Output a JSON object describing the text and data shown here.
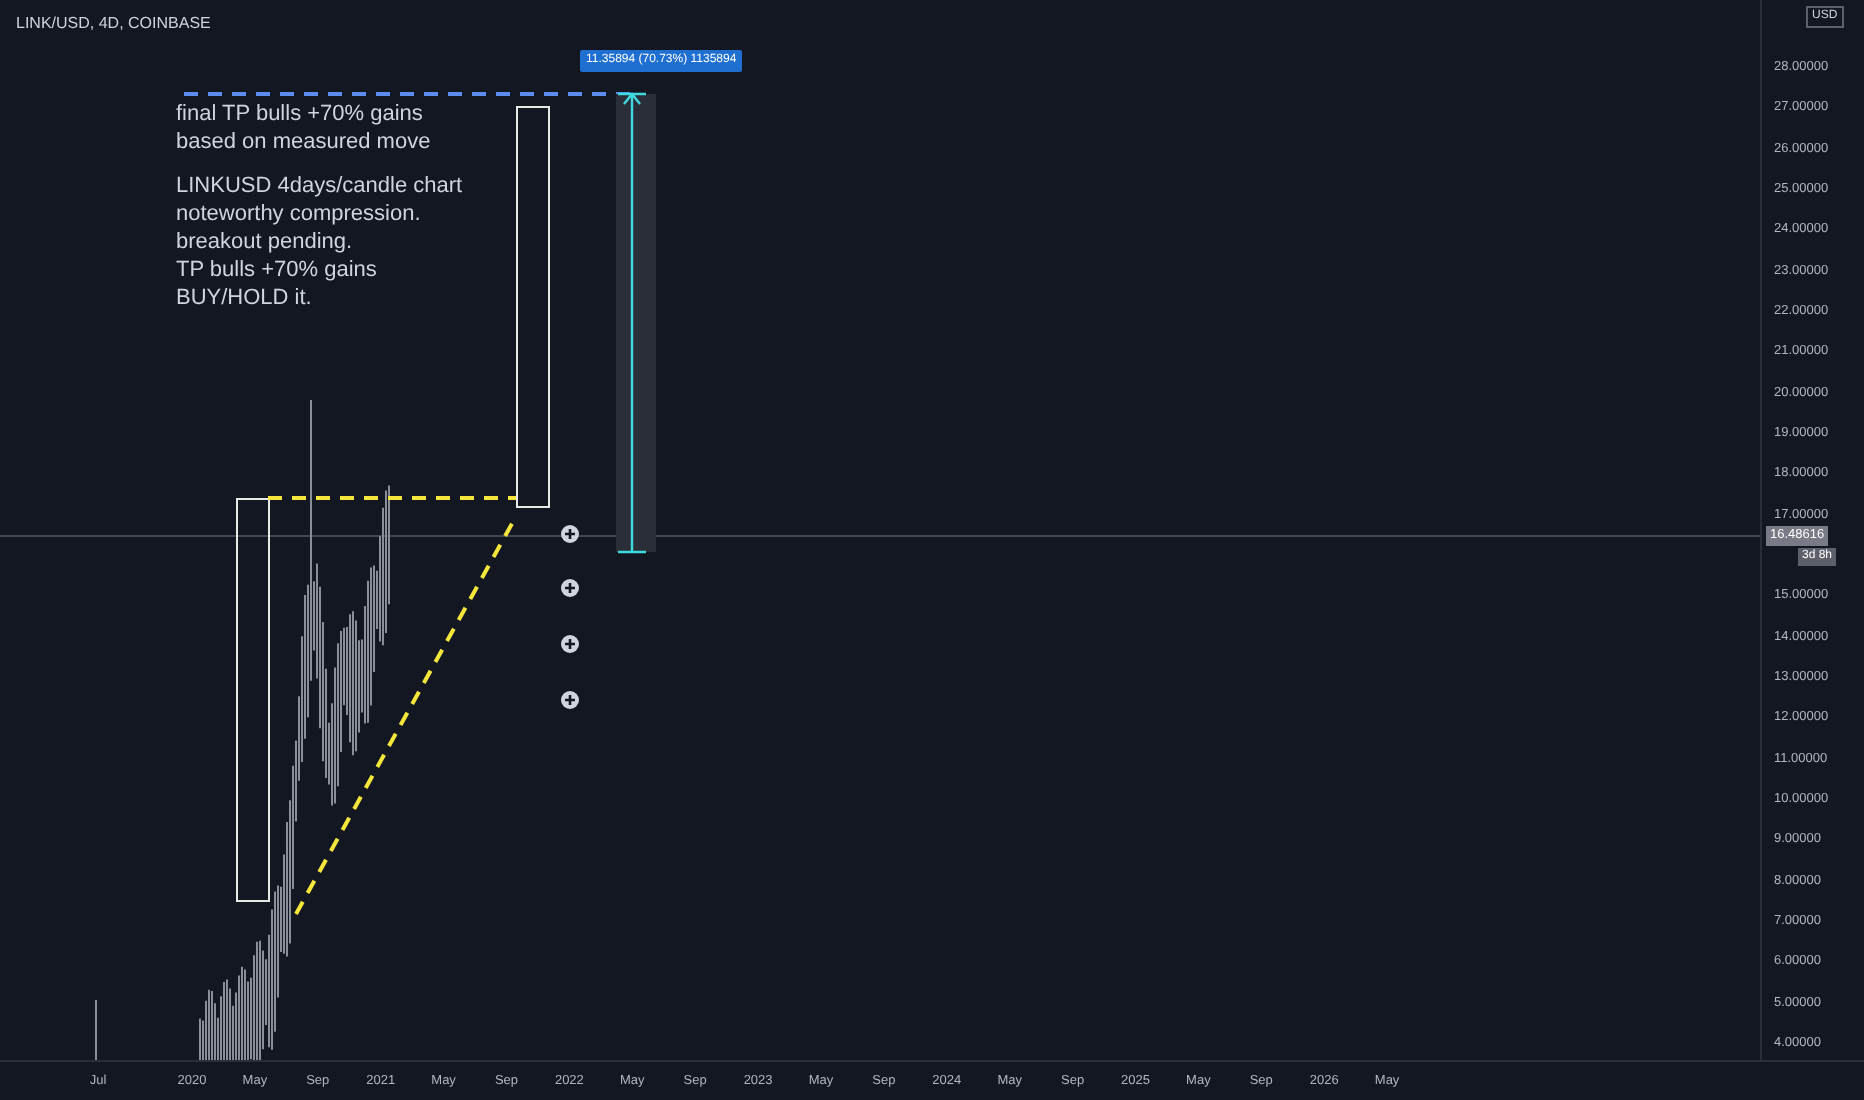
{
  "chart": {
    "symbol_title": "LINK/USD, 4D, COINBASE",
    "notes": [
      {
        "lines": [
          "final TP bulls +70% gains",
          "based on measured move"
        ]
      },
      {
        "lines": [
          "LINKUSD 4days/candle chart",
          "noteworthy compression.",
          "breakout pending.",
          "TP bulls +70% gains",
          "BUY/HOLD it."
        ]
      }
    ],
    "measure_label": "11.35894 (70.73%) 1135894"
  },
  "price_axis": {
    "currency": "USD",
    "labels": [
      "28.00000",
      "27.00000",
      "26.00000",
      "25.00000",
      "24.00000",
      "23.00000",
      "22.00000",
      "21.00000",
      "20.00000",
      "19.00000",
      "18.00000",
      "17.00000",
      "15.00000",
      "14.00000",
      "13.00000",
      "12.00000",
      "11.00000",
      "10.00000",
      "9.00000",
      "8.00000",
      "7.00000",
      "6.00000",
      "5.00000",
      "4.00000"
    ],
    "last_price": "16.48616",
    "countdown": "3d 8h"
  },
  "time_axis": {
    "labels": [
      "Jul",
      "2020",
      "May",
      "Sep",
      "2021",
      "May",
      "Sep",
      "2022",
      "May",
      "Sep",
      "2023",
      "May",
      "Sep",
      "2024",
      "May",
      "Sep",
      "2025",
      "May",
      "Sep",
      "2026",
      "May"
    ]
  }
}
